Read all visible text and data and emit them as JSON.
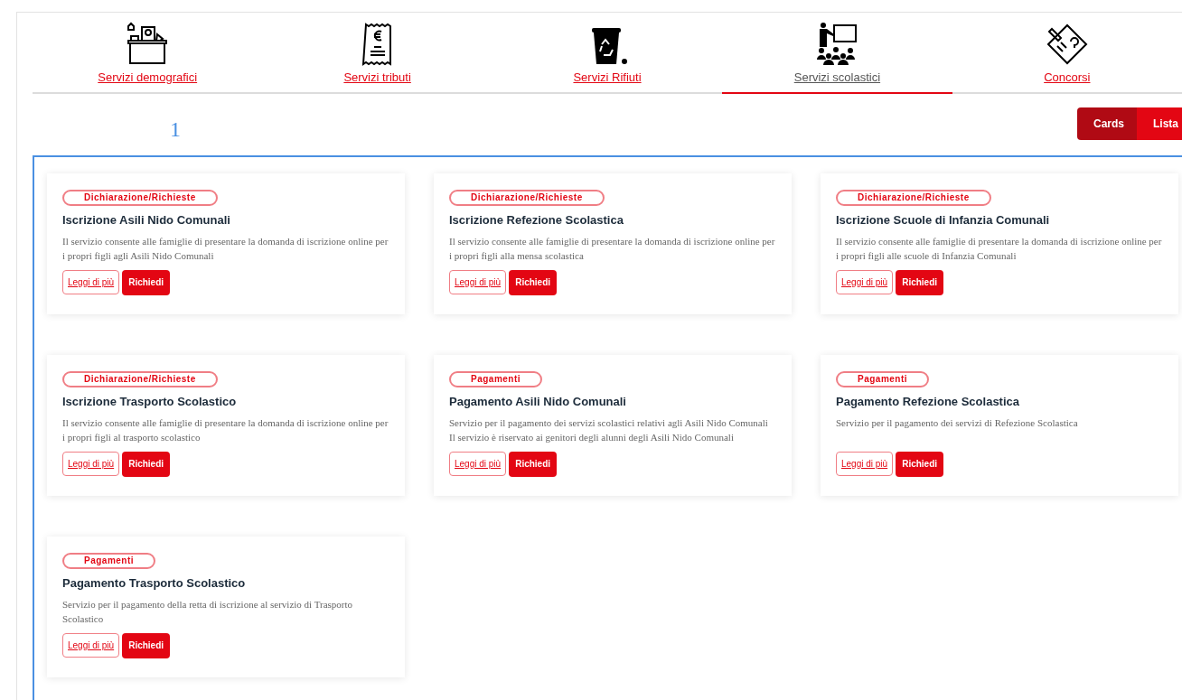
{
  "tabs": [
    {
      "label": "Servizi demografici",
      "selected": false
    },
    {
      "label": "Servizi tributi",
      "selected": false
    },
    {
      "label": "Servizi Rifiuti",
      "selected": false
    },
    {
      "label": "Servizi scolastici",
      "selected": true
    },
    {
      "label": "Concorsi",
      "selected": false
    }
  ],
  "view_toggle": [
    {
      "label": "Cards",
      "selected": true
    },
    {
      "label": "Lista",
      "selected": false
    }
  ],
  "page_number": "1",
  "cards": [
    {
      "category": "Dichiarazione/Richieste",
      "title": "Iscrizione Asili Nido Comunali",
      "description": "Il servizio consente alle famiglie di presentare la domanda di iscrizione online per i propri figli agli Asili Nido Comunali",
      "more": "Leggi di più",
      "request": "Richiedi"
    },
    {
      "category": "Dichiarazione/Richieste",
      "title": "Iscrizione Refezione Scolastica",
      "description": "Il servizio consente alle famiglie di presentare la domanda di iscrizione online per i propri figli alla mensa scolastica",
      "more": "Leggi di più",
      "request": "Richiedi"
    },
    {
      "category": "Dichiarazione/Richieste",
      "title": "Iscrizione Scuole di Infanzia Comunali",
      "description": "Il servizio consente alle famiglie di presentare la domanda di iscrizione online per i propri figli alle scuole di Infanzia Comunali",
      "more": "Leggi di più",
      "request": "Richiedi"
    },
    {
      "category": "Dichiarazione/Richieste",
      "title": "Iscrizione Trasporto Scolastico",
      "description": "Il servizio consente alle famiglie di presentare la domanda di iscrizione online per i propri figli al trasporto scolastico",
      "more": "Leggi di più",
      "request": "Richiedi"
    },
    {
      "category": "Pagamenti",
      "title": "Pagamento Asili Nido Comunali",
      "description": "Servizio per il pagamento dei servizi scolastici relativi agli Asili Nido Comunali Il servizio è riservato ai genitori degli alunni degli Asili Nido Comunali",
      "more": "Leggi di più",
      "request": "Richiedi"
    },
    {
      "category": "Pagamenti",
      "title": "Pagamento Refezione Scolastica",
      "description": "Servizio per il pagamento dei servizi di Refezione Scolastica",
      "more": "Leggi di più",
      "request": "Richiedi"
    },
    {
      "category": "Pagamenti",
      "title": "Pagamento Trasporto Scolastico",
      "description": "Servizio per il pagamento della retta di iscrizione al servizio di Trasporto Scolastico",
      "more": "Leggi di più",
      "request": "Richiedi"
    }
  ]
}
